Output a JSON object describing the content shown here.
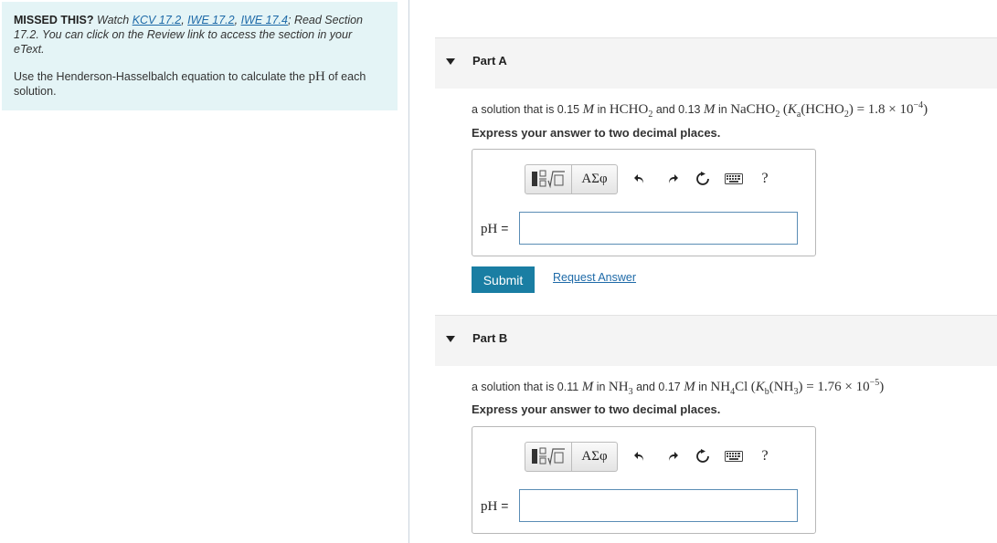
{
  "missed": {
    "bold": "MISSED THIS?",
    "watch": "Watch",
    "links": [
      "KCV 17.2",
      "IWE 17.2",
      "IWE 17.4"
    ],
    "read_text": "Read Section 17.2. You can click on the Review link to access the section in your eText.",
    "instruction_pre": "Use the Henderson-Hasselbalch equation to calculate the",
    "instruction_math": "pH",
    "instruction_post": "of each solution."
  },
  "partA": {
    "label": "Part A",
    "q_pre": "a solution that is 0.15",
    "q_unit": "M",
    "q_in": "in",
    "q_acid": "HCHO",
    "q_and": "and 0.13",
    "q_base": "NaCHO",
    "q_ka": "K",
    "q_ka_sub": "a",
    "q_formula": "(HCHO",
    "q_value": "= 1.8 × 10",
    "q_exp": "−4",
    "express": "Express your answer to two decimal places.",
    "ph_label": "pH",
    "ph_eq": "=",
    "input_value": "",
    "greek_label": "ΑΣφ",
    "help_label": "?"
  },
  "partB": {
    "label": "Part B",
    "q_pre": "a solution that is 0.11",
    "q_unit": "M",
    "q_in": "in",
    "q_acid": "NH",
    "q_and": "and 0.17",
    "q_base": "NH",
    "q_base2": "Cl",
    "q_kb": "K",
    "q_kb_sub": "b",
    "q_formula": "(NH",
    "q_value": "= 1.76 × 10",
    "q_exp": "−5",
    "express": "Express your answer to two decimal places.",
    "ph_label": "pH",
    "ph_eq": "=",
    "input_value": "",
    "greek_label": "ΑΣφ",
    "help_label": "?"
  },
  "actions": {
    "submit_label": "Submit",
    "request_label": "Request Answer"
  },
  "colors": {
    "accent": "#1a7ea3",
    "link": "#1e6aa8",
    "missed_bg": "#e4f4f6"
  }
}
